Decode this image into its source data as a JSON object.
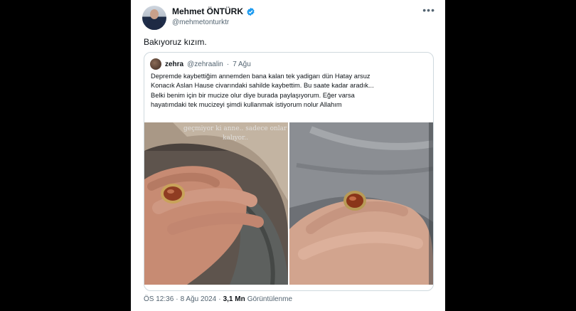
{
  "author": {
    "name": "Mehmet ÖNTÜRK",
    "handle": "@mehmetonturktr"
  },
  "tweet": {
    "text": "Bakıyoruz kızım."
  },
  "quote": {
    "name": "zehra",
    "handle": "@zehraalin",
    "separator": "·",
    "date": "7 Ağu",
    "lines": [
      "Depremde kaybettiğim annemden bana kalan tek yadigarı dün Hatay arsuz",
      "Konacık Aslan Hause civarındaki sahilde kaybettim. Bu saate kadar aradık...",
      "Belki benim için bir mucize olur diye burada paylaşıyorum. Eğer varsa",
      "hayatımdaki tek mucizeyi şimdi kullanmak istiyorum nolur Allahım"
    ],
    "photo_overlay": [
      "geçmiyor ki anne.. sadece onlar",
      "kalıyor.."
    ]
  },
  "footer": {
    "time": "ÖS 12:36",
    "dot1": "·",
    "date": "8 Ağu 2024",
    "dot2": "·",
    "views": "3,1 Mn",
    "views_label": "Görüntülenme"
  },
  "icons": {
    "verified": "verified-badge-icon",
    "more": "more-options-icon"
  },
  "colors": {
    "verified": "#1d9bf0",
    "secondary_text": "#536471"
  }
}
